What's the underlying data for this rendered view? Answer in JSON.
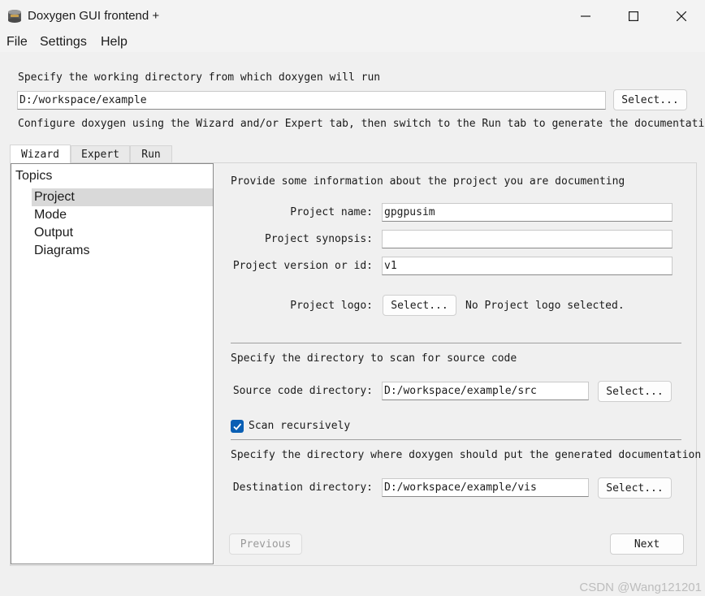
{
  "window": {
    "title": "Doxygen GUI frontend +",
    "icon": "doxygen-app-icon"
  },
  "menu": {
    "items": [
      "File",
      "Settings",
      "Help"
    ]
  },
  "workdir": {
    "prompt": "Specify the working directory from which doxygen will run",
    "value": "D:/workspace/example",
    "select_label": "Select...",
    "hint": "Configure doxygen using the Wizard and/or Expert tab, then switch to the Run tab to generate the documentation"
  },
  "tabs": [
    "Wizard",
    "Expert",
    "Run"
  ],
  "topics": {
    "header": "Topics",
    "items": [
      "Project",
      "Mode",
      "Output",
      "Diagrams"
    ],
    "selected": "Project"
  },
  "project": {
    "section_title": "Provide some information about the project you are documenting",
    "name_label": "Project name:",
    "name_value": "gpgpusim",
    "synopsis_label": "Project synopsis:",
    "synopsis_value": "",
    "version_label": "Project version or id:",
    "version_value": "v1",
    "logo_label": "Project logo:",
    "logo_button": "Select...",
    "logo_status": "No Project logo selected."
  },
  "source": {
    "section_title": "Specify the directory to scan for source code",
    "dir_label": "Source code directory:",
    "dir_value": "D:/workspace/example/src",
    "select_label": "Select...",
    "recursive_label": "Scan recursively",
    "recursive_checked": true
  },
  "destination": {
    "section_title": "Specify the directory where doxygen should put the generated documentation",
    "dir_label": "Destination directory:",
    "dir_value": "D:/workspace/example/vis",
    "select_label": "Select..."
  },
  "nav": {
    "previous_label": "Previous",
    "next_label": "Next"
  },
  "watermark": "CSDN @Wang121201",
  "colors": {
    "accent": "#0a5fb4",
    "selection": "#d9d9d9",
    "background": "#f0f0f0"
  }
}
